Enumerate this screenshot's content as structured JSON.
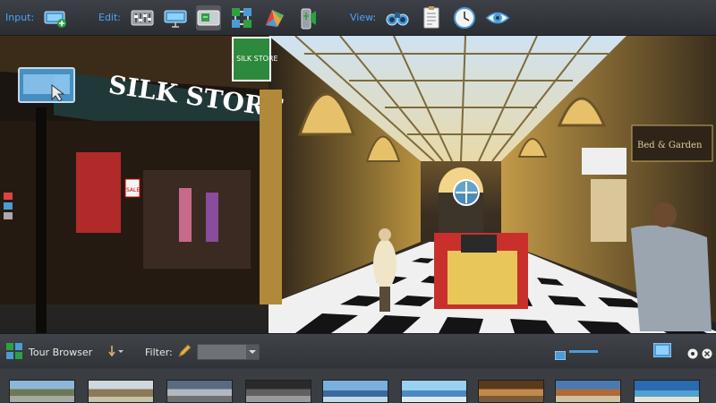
{
  "toolbar": {
    "input_label": "Input:",
    "edit_label": "Edit:",
    "view_label": "View:"
  },
  "viewer": {
    "storefront_sign": "SILK STORE",
    "green_sign": "SILK STORE",
    "shop_sign_right": "Bed & Garden",
    "price_tag": "SALE"
  },
  "browser": {
    "title": "Tour Browser",
    "filter_label": "Filter:",
    "thumbnail_count": 9
  },
  "colors": {
    "accent_label": "#4da3ff",
    "toolbar_bg": "#2b2e33"
  }
}
